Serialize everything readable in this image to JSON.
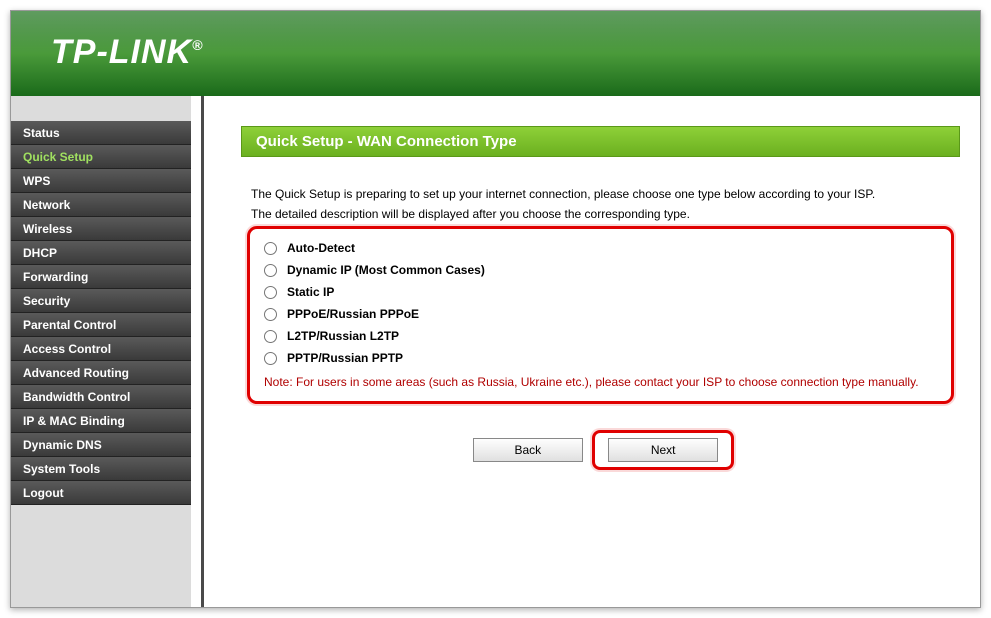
{
  "header": {
    "logo_text": "TP-LINK",
    "logo_reg": "®"
  },
  "sidebar": {
    "items": [
      {
        "label": "Status",
        "active": false
      },
      {
        "label": "Quick Setup",
        "active": true
      },
      {
        "label": "WPS",
        "active": false
      },
      {
        "label": "Network",
        "active": false
      },
      {
        "label": "Wireless",
        "active": false
      },
      {
        "label": "DHCP",
        "active": false
      },
      {
        "label": "Forwarding",
        "active": false
      },
      {
        "label": "Security",
        "active": false
      },
      {
        "label": "Parental Control",
        "active": false
      },
      {
        "label": "Access Control",
        "active": false
      },
      {
        "label": "Advanced Routing",
        "active": false
      },
      {
        "label": "Bandwidth Control",
        "active": false
      },
      {
        "label": "IP & MAC Binding",
        "active": false
      },
      {
        "label": "Dynamic DNS",
        "active": false
      },
      {
        "label": "System Tools",
        "active": false
      },
      {
        "label": "Logout",
        "active": false
      }
    ]
  },
  "content": {
    "title": "Quick Setup - WAN Connection Type",
    "intro_line1": "The Quick Setup is preparing to set up your internet connection, please choose one type below according to your ISP.",
    "intro_line2": "The detailed description will be displayed after you choose the corresponding type.",
    "options": [
      "Auto-Detect",
      "Dynamic IP (Most Common Cases)",
      "Static IP",
      "PPPoE/Russian PPPoE",
      "L2TP/Russian L2TP",
      "PPTP/Russian PPTP"
    ],
    "note": "Note: For users in some areas (such as Russia, Ukraine etc.), please contact your ISP to choose connection type manually.",
    "buttons": {
      "back": "Back",
      "next": "Next"
    }
  }
}
